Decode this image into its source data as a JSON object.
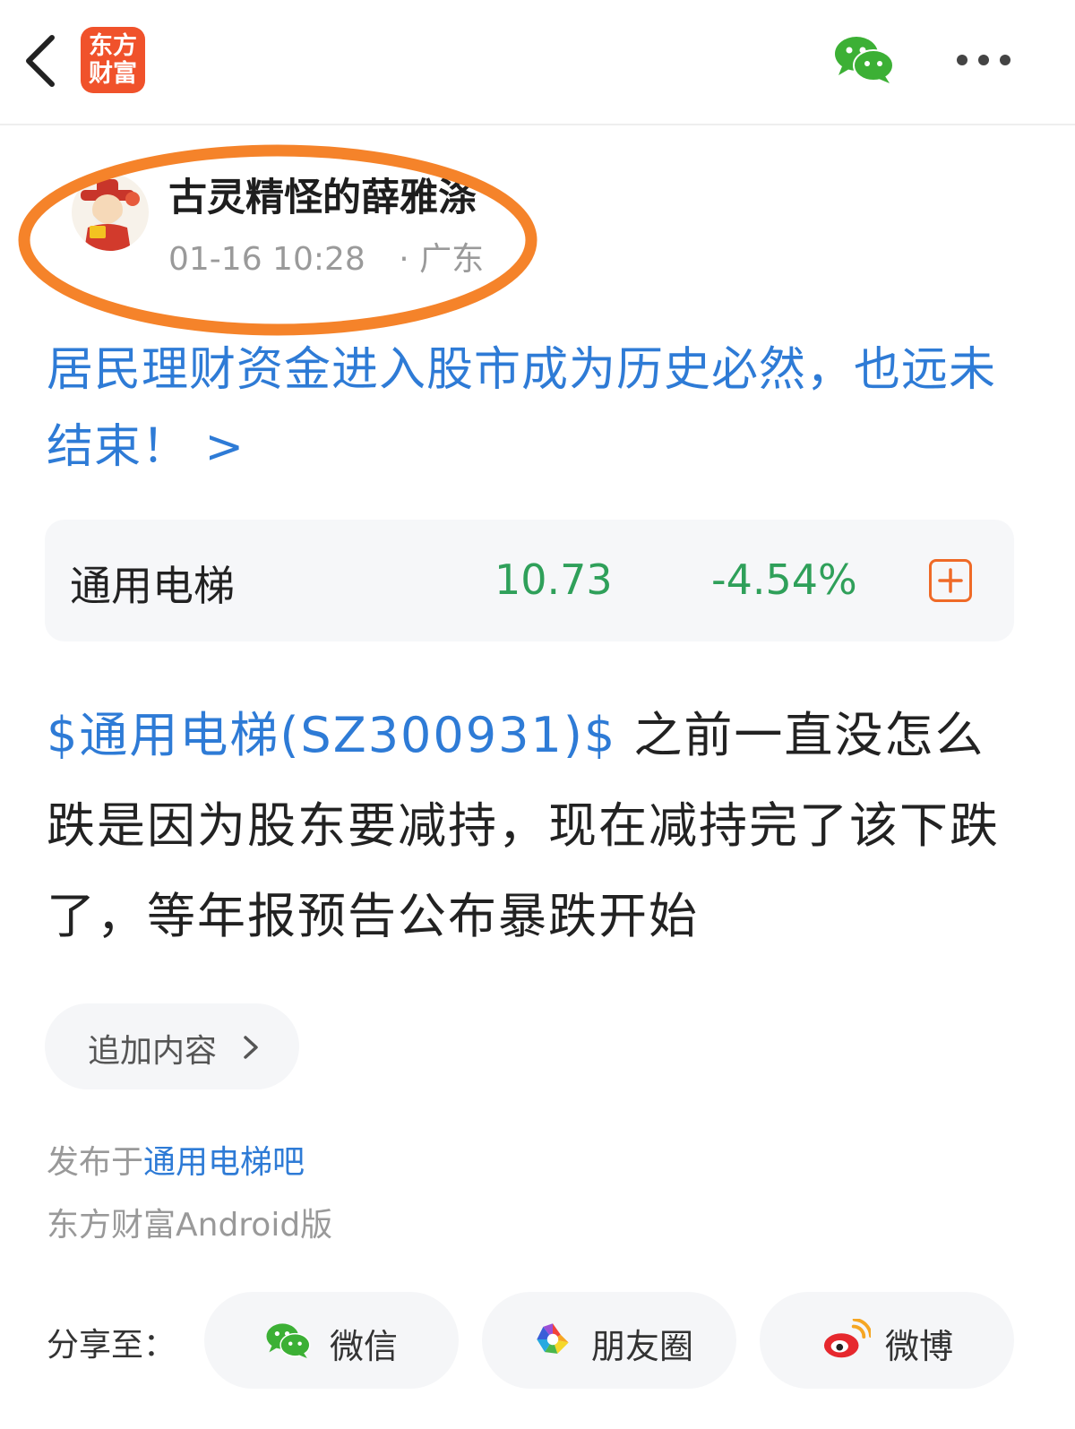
{
  "header": {
    "logo_line1": "东方",
    "logo_line2": "财富"
  },
  "post": {
    "author_name": "古灵精怪的薛雅涤",
    "time": "01-16 10:28",
    "location": "· 广东",
    "headline": "居民理财资金进入股市成为历史必然，也远未结束！ >",
    "stock_card": {
      "name": "通用电梯",
      "price": "10.73",
      "change": "-4.54%"
    },
    "body_stock_link": "$通用电梯(SZ300931)$",
    "body_text": " 之前一直没怎么跌是因为股东要减持，现在减持完了该下跌了，等年报预告公布暴跌开始",
    "append_label": "追加内容",
    "posted_in_prefix": "发布于",
    "posted_in_bar": "通用电梯吧",
    "client": "东方财富Android版"
  },
  "share": {
    "label": "分享至：",
    "wechat": "微信",
    "moments": "朋友圈",
    "weibo": "微博"
  },
  "colors": {
    "link_blue": "#2e7bd6",
    "down_green": "#2fa05a",
    "brand_orange": "#f0522b",
    "annotation_orange": "#f5832a"
  },
  "icons": [
    "back-icon",
    "wechat-icon",
    "more-icon",
    "add-icon",
    "chevron-right-icon",
    "moments-icon",
    "weibo-icon"
  ]
}
